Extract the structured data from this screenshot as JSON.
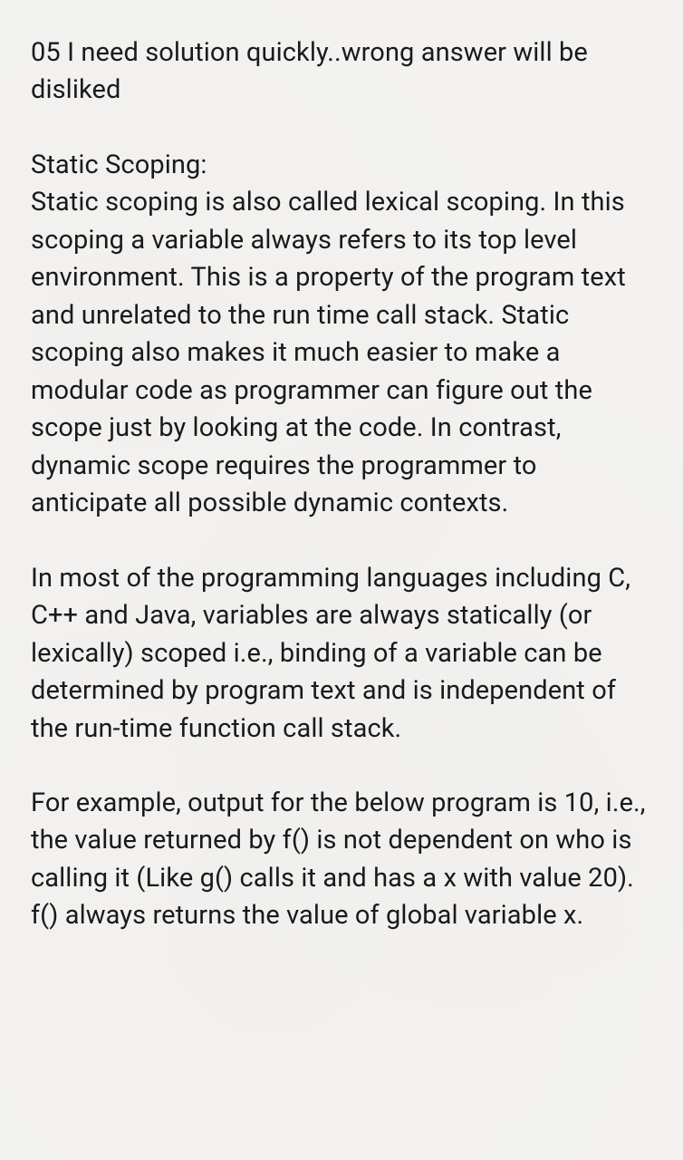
{
  "document": {
    "intro_line": "05 I need solution quickly..wrong answer will be disliked",
    "heading": "Static Scoping:",
    "paragraph_1": "Static scoping is also called lexical scoping. In this scoping a variable always refers to its top level environment. This is a property of the program text and unrelated to the run time call stack. Static scoping also makes it much easier to make a modular code as programmer can figure out the scope just by looking at the code. In contrast, dynamic scope requires the programmer to anticipate all possible dynamic contexts.",
    "paragraph_2": "In most of the programming languages including C, C++ and Java, variables are always statically (or lexically) scoped i.e., binding of a variable can be determined by program text and is independent of the run-time function call stack.",
    "paragraph_3": "For example, output for the below program is 10, i.e., the value returned by f() is not dependent on who is calling it (Like g() calls it and has a x with value 20). f() always returns the value of global variable x."
  }
}
